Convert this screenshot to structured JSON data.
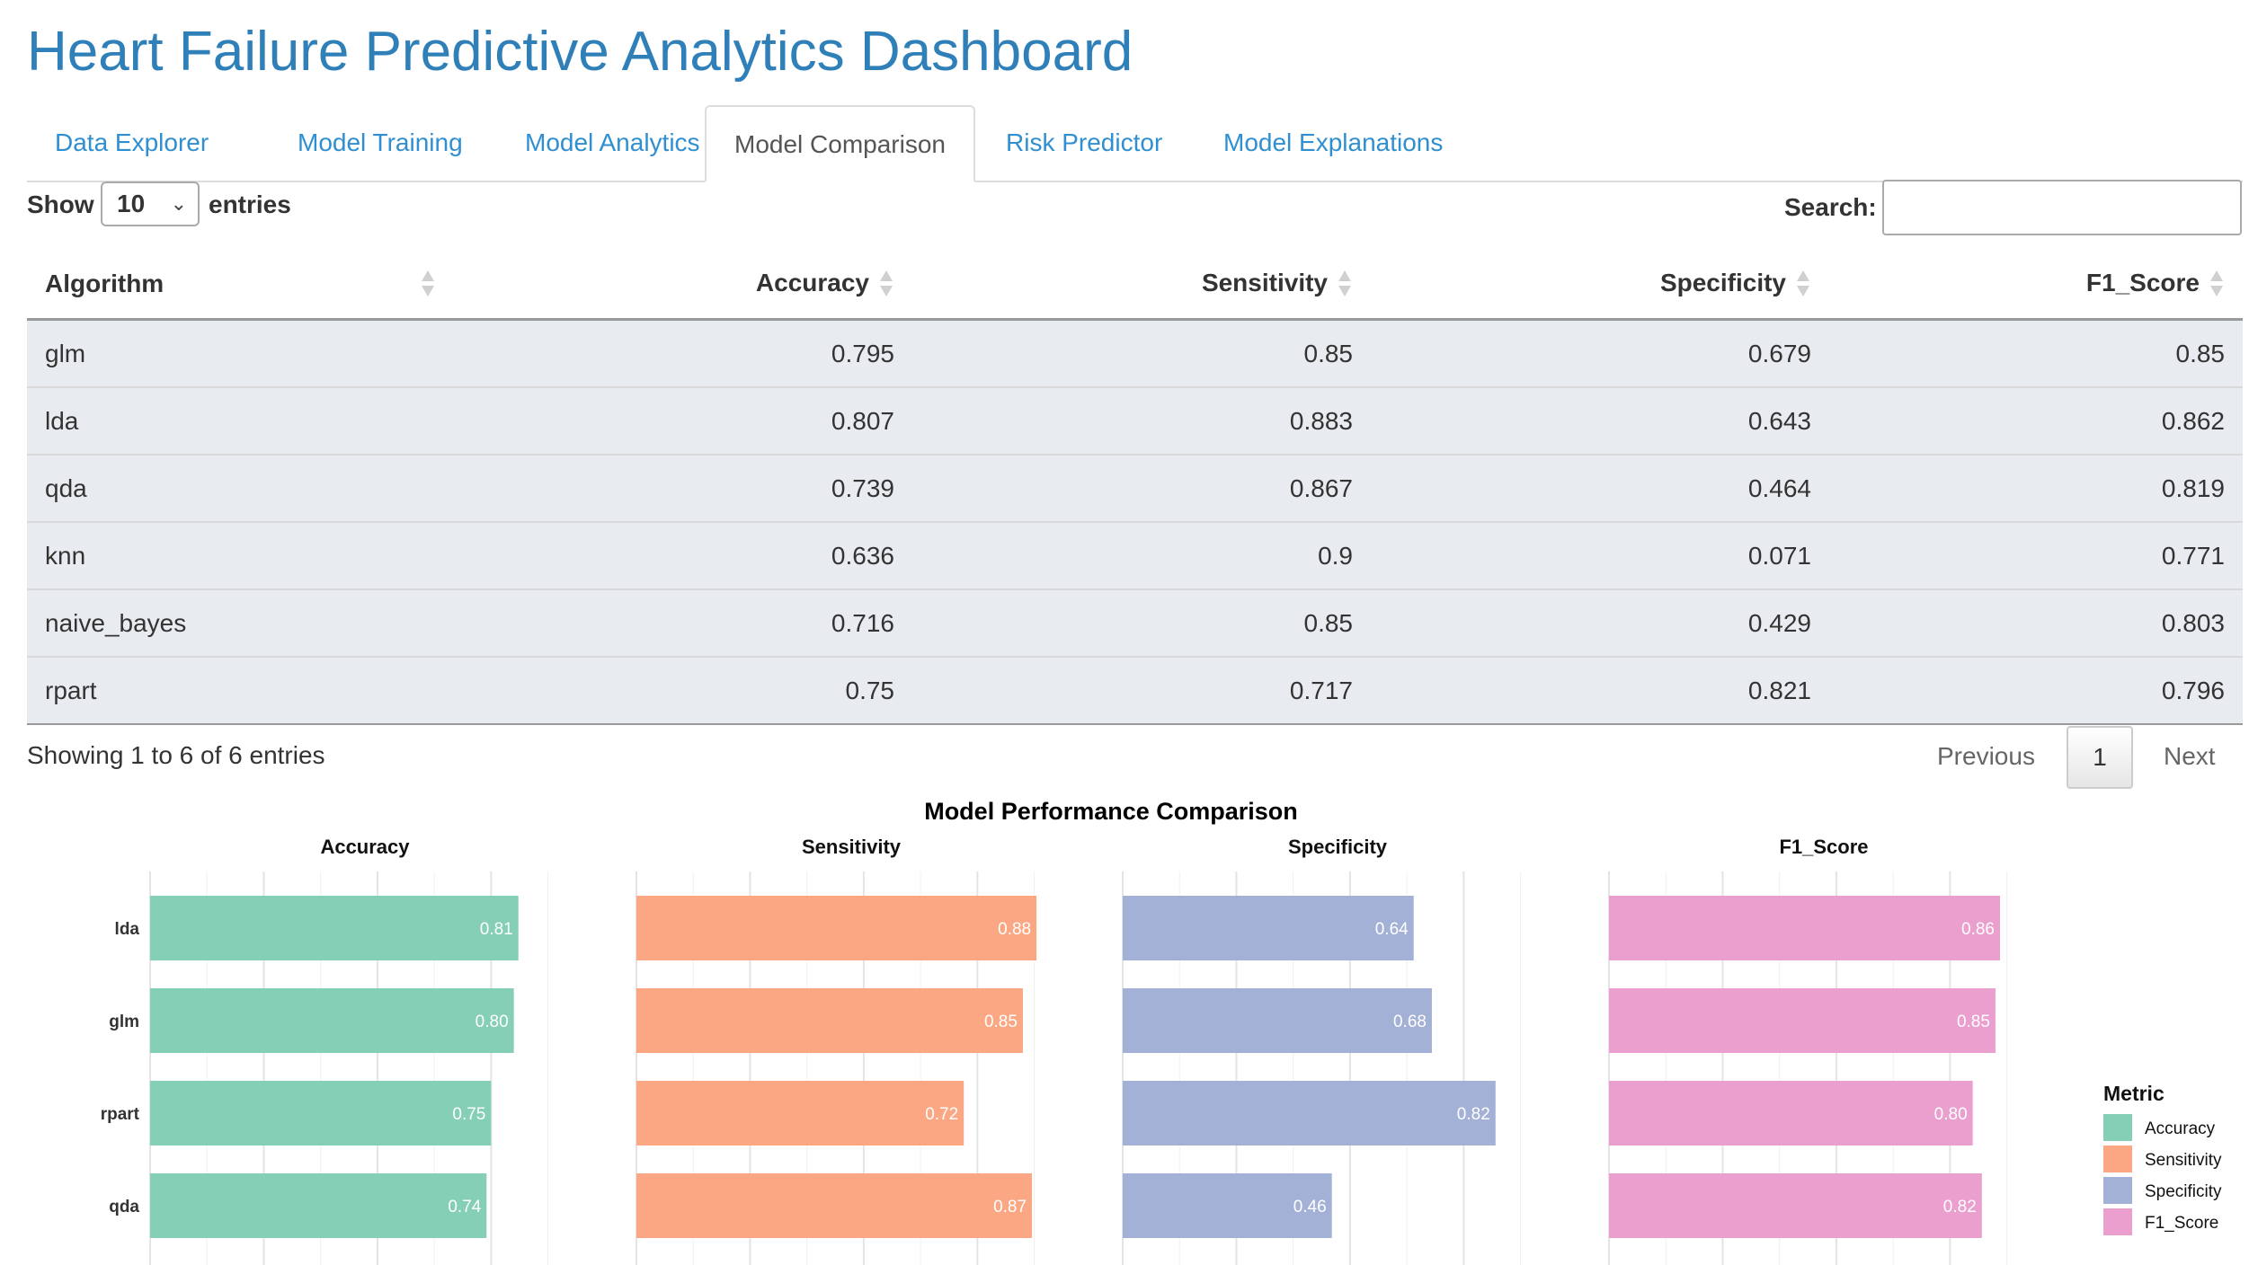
{
  "page": {
    "title": "Heart Failure Predictive Analytics Dashboard"
  },
  "tabs": [
    {
      "label": "Data Explorer",
      "active": false
    },
    {
      "label": "Model Training",
      "active": false
    },
    {
      "label": "Model Analytics",
      "active": false
    },
    {
      "label": "Model Comparison",
      "active": true
    },
    {
      "label": "Risk Predictor",
      "active": false
    },
    {
      "label": "Model Explanations",
      "active": false
    }
  ],
  "table_controls": {
    "show_label": "Show",
    "entries_value": "10",
    "entries_label": "entries",
    "search_label": "Search:",
    "search_value": ""
  },
  "table": {
    "columns": [
      "Algorithm",
      "Accuracy",
      "Sensitivity",
      "Specificity",
      "F1_Score"
    ],
    "rows": [
      [
        "glm",
        "0.795",
        "0.85",
        "0.679",
        "0.85"
      ],
      [
        "lda",
        "0.807",
        "0.883",
        "0.643",
        "0.862"
      ],
      [
        "qda",
        "0.739",
        "0.867",
        "0.464",
        "0.819"
      ],
      [
        "knn",
        "0.636",
        "0.9",
        "0.071",
        "0.771"
      ],
      [
        "naive_bayes",
        "0.716",
        "0.85",
        "0.429",
        "0.803"
      ],
      [
        "rpart",
        "0.75",
        "0.717",
        "0.821",
        "0.796"
      ]
    ]
  },
  "pagination": {
    "info": "Showing 1 to 6 of 6 entries",
    "previous": "Previous",
    "current": "1",
    "next": "Next"
  },
  "chart_data": {
    "type": "bar",
    "orientation": "horizontal",
    "title": "Model Performance Comparison",
    "categories": [
      "lda",
      "glm",
      "rpart",
      "qda"
    ],
    "series": [
      {
        "name": "Accuracy",
        "color": "#85cfb6",
        "values": [
          0.81,
          0.8,
          0.75,
          0.74
        ]
      },
      {
        "name": "Sensitivity",
        "color": "#fba784",
        "values": [
          0.88,
          0.85,
          0.72,
          0.87
        ]
      },
      {
        "name": "Specificity",
        "color": "#a3b1d6",
        "values": [
          0.64,
          0.68,
          0.82,
          0.46
        ]
      },
      {
        "name": "F1_Score",
        "color": "#ea9fcf",
        "values": [
          0.86,
          0.85,
          0.8,
          0.82
        ]
      }
    ],
    "xlim": [
      0,
      0.9
    ],
    "grid": true,
    "legend": {
      "title": "Metric",
      "placement": "right"
    },
    "xlabel": "",
    "ylabel": ""
  }
}
